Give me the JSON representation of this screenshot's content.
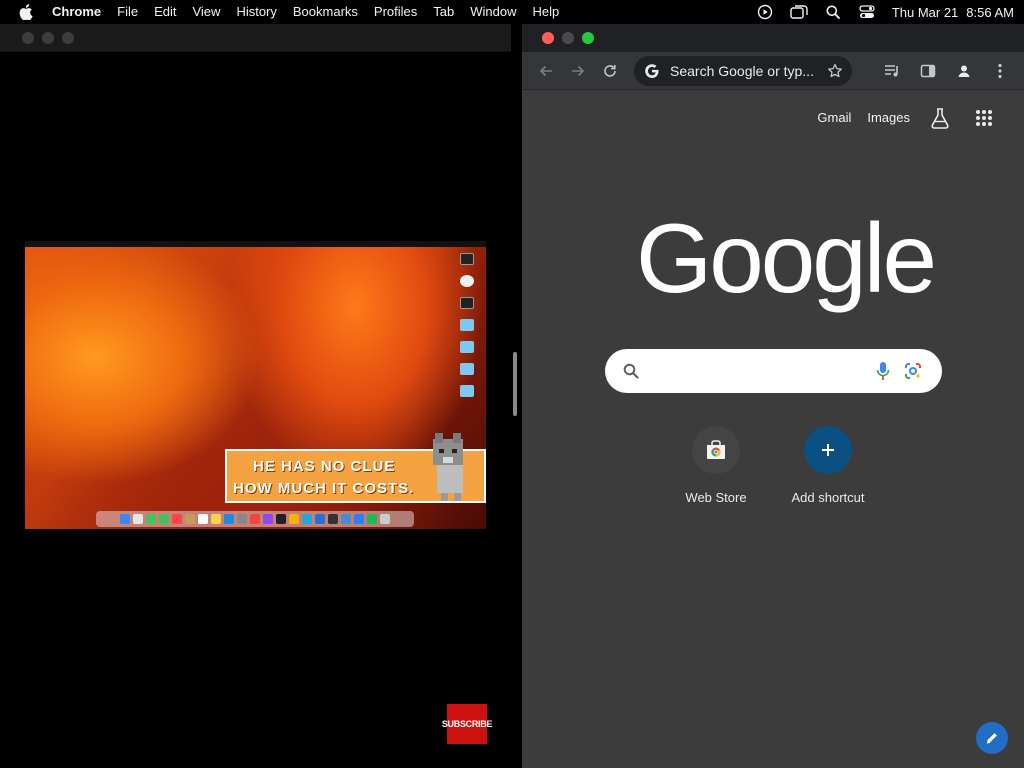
{
  "menubar": {
    "app": "Chrome",
    "items": [
      "File",
      "Edit",
      "View",
      "History",
      "Bookmarks",
      "Profiles",
      "Tab",
      "Window",
      "Help"
    ],
    "date": "Thu Mar 21",
    "time": "8:56 AM"
  },
  "video": {
    "caption_line1": "HE HAS NO CLUE",
    "caption_line2": "HOW MUCH IT COSTS.",
    "subscribe_label": "SUBSCRIBE"
  },
  "chrome": {
    "omnibox_placeholder": "Search Google or typ...",
    "header_links": [
      "Gmail",
      "Images"
    ],
    "logo_text": "Google",
    "search_placeholder": "",
    "shortcuts": [
      {
        "label": "Web Store"
      },
      {
        "label": "Add shortcut"
      }
    ],
    "colors": {
      "toolbar": "#35363a",
      "ntp_background": "#3c3c3c",
      "accent": "#0b4f83"
    }
  }
}
